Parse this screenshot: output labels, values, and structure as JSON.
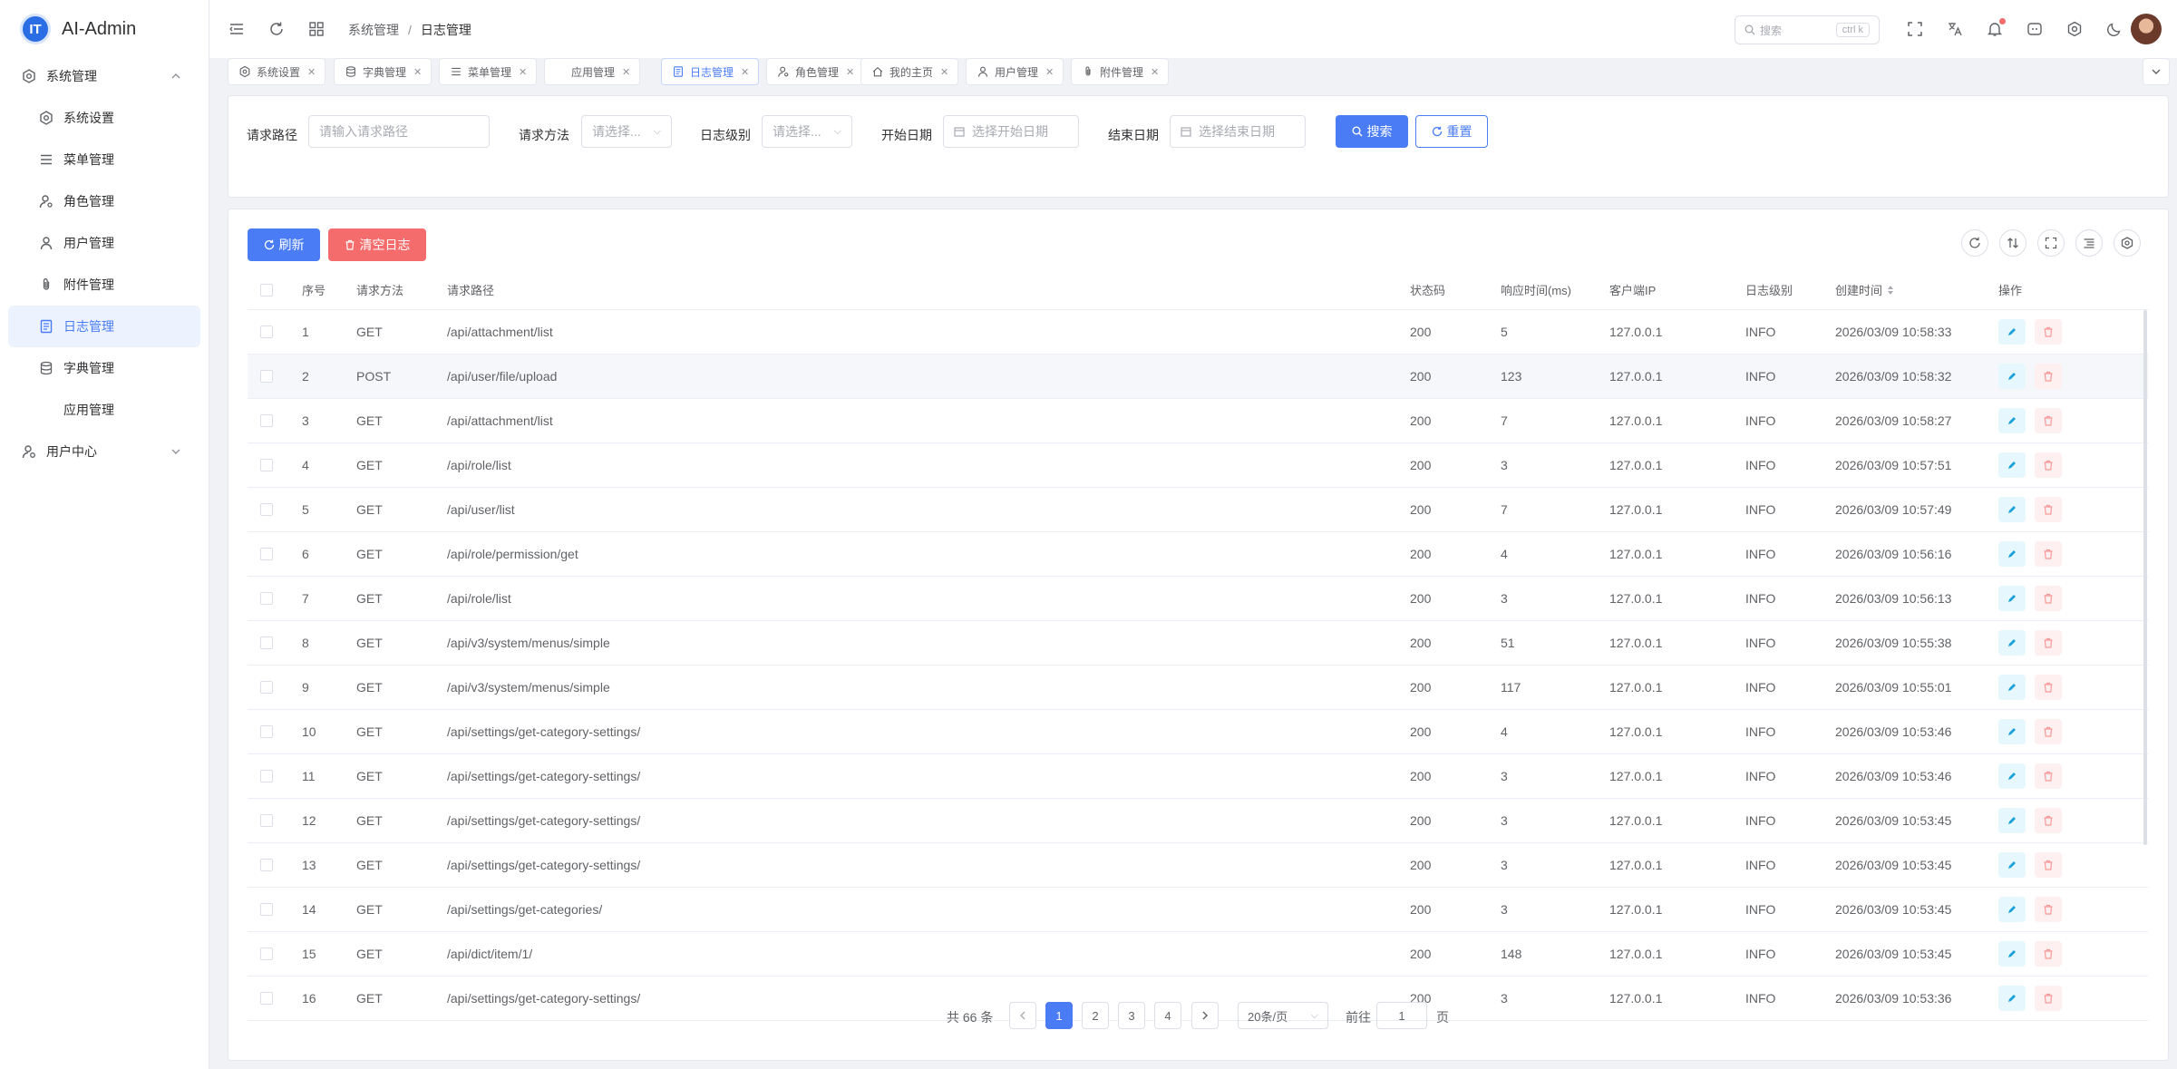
{
  "app": {
    "name": "AI-Admin",
    "logo_text": "IT"
  },
  "sidebar": {
    "groups": [
      {
        "label": "系统管理",
        "icon": "gear-icon",
        "expanded": true
      },
      {
        "label": "用户中心",
        "icon": "user-center-icon",
        "expanded": false
      }
    ],
    "items": [
      {
        "label": "系统设置",
        "icon": "gear-icon"
      },
      {
        "label": "菜单管理",
        "icon": "menu-icon"
      },
      {
        "label": "角色管理",
        "icon": "role-icon"
      },
      {
        "label": "用户管理",
        "icon": "user-icon"
      },
      {
        "label": "附件管理",
        "icon": "paperclip-icon"
      },
      {
        "label": "日志管理",
        "icon": "log-icon",
        "active": true
      },
      {
        "label": "字典管理",
        "icon": "database-icon"
      },
      {
        "label": "应用管理",
        "icon": ""
      }
    ]
  },
  "topbar": {
    "breadcrumb": [
      "系统管理",
      "日志管理"
    ],
    "search_placeholder": "搜索",
    "search_shortcut": "ctrl k"
  },
  "tabs": [
    {
      "label": "系统设置",
      "icon": "gear-icon"
    },
    {
      "label": "字典管理",
      "icon": "database-icon"
    },
    {
      "label": "菜单管理",
      "icon": "menu-icon"
    },
    {
      "label": "应用管理",
      "icon": ""
    },
    {
      "label": "日志管理",
      "icon": "log-icon",
      "active": true
    },
    {
      "label": "角色管理",
      "icon": "role-icon"
    },
    {
      "label": "我的主页",
      "icon": "home-icon"
    },
    {
      "label": "用户管理",
      "icon": "user-icon"
    },
    {
      "label": "附件管理",
      "icon": "paperclip-icon"
    }
  ],
  "filters": {
    "path_label": "请求路径",
    "path_placeholder": "请输入请求路径",
    "method_label": "请求方法",
    "method_placeholder": "请选择...",
    "level_label": "日志级别",
    "level_placeholder": "请选择...",
    "start_label": "开始日期",
    "start_placeholder": "选择开始日期",
    "end_label": "结束日期",
    "end_placeholder": "选择结束日期",
    "search_button": "搜索",
    "reset_button": "重置"
  },
  "toolbar": {
    "refresh_button": "刷新",
    "clear_button": "清空日志"
  },
  "table": {
    "columns": [
      "序号",
      "请求方法",
      "请求路径",
      "状态码",
      "响应时间(ms)",
      "客户端IP",
      "日志级别",
      "创建时间",
      "操作"
    ],
    "rows": [
      [
        "1",
        "GET",
        "/api/attachment/list",
        "200",
        "5",
        "127.0.0.1",
        "INFO",
        "2026/03/09 10:58:33"
      ],
      [
        "2",
        "POST",
        "/api/user/file/upload",
        "200",
        "123",
        "127.0.0.1",
        "INFO",
        "2026/03/09 10:58:32"
      ],
      [
        "3",
        "GET",
        "/api/attachment/list",
        "200",
        "7",
        "127.0.0.1",
        "INFO",
        "2026/03/09 10:58:27"
      ],
      [
        "4",
        "GET",
        "/api/role/list",
        "200",
        "3",
        "127.0.0.1",
        "INFO",
        "2026/03/09 10:57:51"
      ],
      [
        "5",
        "GET",
        "/api/user/list",
        "200",
        "7",
        "127.0.0.1",
        "INFO",
        "2026/03/09 10:57:49"
      ],
      [
        "6",
        "GET",
        "/api/role/permission/get",
        "200",
        "4",
        "127.0.0.1",
        "INFO",
        "2026/03/09 10:56:16"
      ],
      [
        "7",
        "GET",
        "/api/role/list",
        "200",
        "3",
        "127.0.0.1",
        "INFO",
        "2026/03/09 10:56:13"
      ],
      [
        "8",
        "GET",
        "/api/v3/system/menus/simple",
        "200",
        "51",
        "127.0.0.1",
        "INFO",
        "2026/03/09 10:55:38"
      ],
      [
        "9",
        "GET",
        "/api/v3/system/menus/simple",
        "200",
        "117",
        "127.0.0.1",
        "INFO",
        "2026/03/09 10:55:01"
      ],
      [
        "10",
        "GET",
        "/api/settings/get-category-settings/",
        "200",
        "4",
        "127.0.0.1",
        "INFO",
        "2026/03/09 10:53:46"
      ],
      [
        "11",
        "GET",
        "/api/settings/get-category-settings/",
        "200",
        "3",
        "127.0.0.1",
        "INFO",
        "2026/03/09 10:53:46"
      ],
      [
        "12",
        "GET",
        "/api/settings/get-category-settings/",
        "200",
        "3",
        "127.0.0.1",
        "INFO",
        "2026/03/09 10:53:45"
      ],
      [
        "13",
        "GET",
        "/api/settings/get-category-settings/",
        "200",
        "3",
        "127.0.0.1",
        "INFO",
        "2026/03/09 10:53:45"
      ],
      [
        "14",
        "GET",
        "/api/settings/get-categories/",
        "200",
        "3",
        "127.0.0.1",
        "INFO",
        "2026/03/09 10:53:45"
      ],
      [
        "15",
        "GET",
        "/api/dict/item/1/",
        "200",
        "148",
        "127.0.0.1",
        "INFO",
        "2026/03/09 10:53:45"
      ],
      [
        "16",
        "GET",
        "/api/settings/get-category-settings/",
        "200",
        "3",
        "127.0.0.1",
        "INFO",
        "2026/03/09 10:53:36"
      ]
    ]
  },
  "pagination": {
    "total_text": "共 66 条",
    "pages": [
      "1",
      "2",
      "3",
      "4"
    ],
    "current": "1",
    "page_size": "20条/页",
    "goto_label": "前往",
    "goto_value": "1",
    "goto_suffix": "页"
  },
  "colors": {
    "primary": "#4a7cf6",
    "danger": "#f56c6c",
    "edit": "#1aa2d8"
  }
}
